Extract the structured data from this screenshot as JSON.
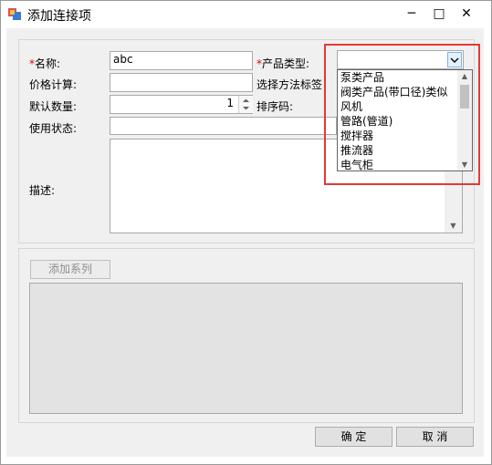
{
  "window": {
    "title": "添加连接项",
    "icon": "app-form-icon"
  },
  "controls": {
    "minimize": "─",
    "maximize": "□",
    "close": "✕"
  },
  "form": {
    "name_label": "名称:",
    "name_required": "*",
    "name_value": "abc",
    "price_label": "价格计算:",
    "price_value": "",
    "default_qty_label": "默认数量:",
    "default_qty_value": "1",
    "usage_label": "使用状态:",
    "usage_value": "",
    "desc_label": "描述:",
    "desc_value": "",
    "product_type_label": "产品类型:",
    "product_type_required": "*",
    "product_type_value": "",
    "method_tag_label": "选择方法标签",
    "sort_label": "排序码:"
  },
  "dropdown": {
    "items": [
      "泵类产品",
      "阀类产品(带口径)类似",
      "风机",
      "管路(管道)",
      "搅拌器",
      "推流器",
      "电气柜"
    ]
  },
  "series": {
    "add_label": "添加系列"
  },
  "footer": {
    "ok_label": "确 定",
    "cancel_label": "取 消"
  },
  "colors": {
    "highlight_box": "#e53935",
    "required_star": "#e00000",
    "client_bg": "#f0f0f0"
  }
}
